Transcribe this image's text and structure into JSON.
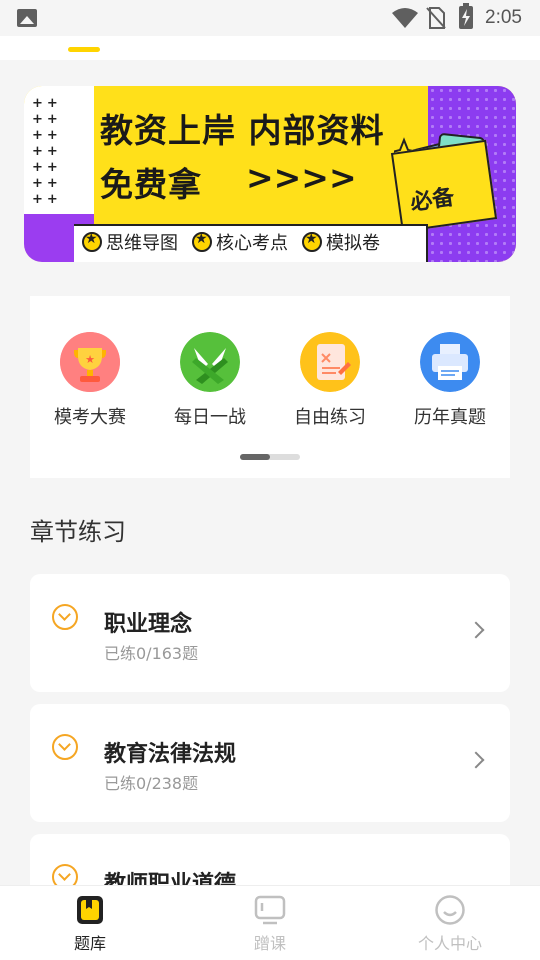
{
  "status_bar": {
    "time": "2:05"
  },
  "banner": {
    "title_line1": "教资上岸 内部资料",
    "title_line2": "免费拿",
    "arrows": ">>>>",
    "badge": "必备",
    "tags": [
      "思维导图",
      "核心考点",
      "模拟卷"
    ]
  },
  "quick_entries": [
    {
      "label": "模考大赛",
      "icon": "trophy-icon",
      "color": "#f76b6b"
    },
    {
      "label": "每日一战",
      "icon": "pen-nib-icon",
      "color": "#56c03b"
    },
    {
      "label": "自由练习",
      "icon": "scroll-shuffle-icon",
      "color": "#ffc21a"
    },
    {
      "label": "历年真题",
      "icon": "printer-icon",
      "color": "#3d8bf0"
    }
  ],
  "section": {
    "title": "章节练习"
  },
  "chapters": [
    {
      "name": "职业理念",
      "progress": "已练0/163题"
    },
    {
      "name": "教育法律法规",
      "progress": "已练0/238题"
    },
    {
      "name": "教师职业道德",
      "progress": ""
    }
  ],
  "bottom_nav": [
    {
      "label": "题库",
      "active": true
    },
    {
      "label": "蹭课",
      "active": false
    },
    {
      "label": "个人中心",
      "active": false
    }
  ],
  "colors": {
    "accent": "#ffd400",
    "chevron": "#f5a623",
    "inactive": "#c0c0c0"
  }
}
